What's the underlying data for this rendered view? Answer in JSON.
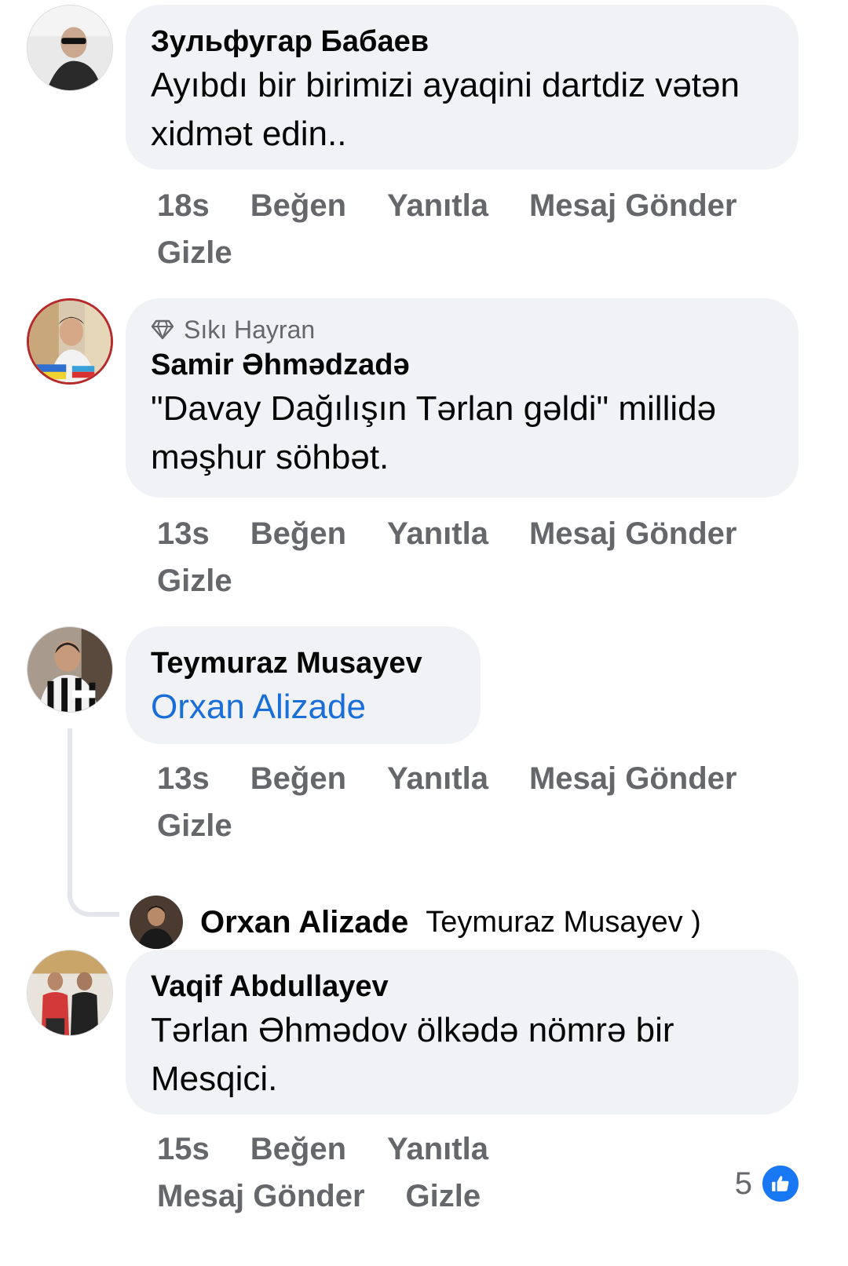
{
  "comments": [
    {
      "author": "Зульфугар Бабаев",
      "text": "Ayıbdı bir birimizi ayaqini dartdiz vətən xidmət edin..",
      "time": "18s",
      "actions": [
        "Beğen",
        "Yanıtla",
        "Mesaj Gönder",
        "Gizle"
      ]
    },
    {
      "badge": "Sıkı Hayran",
      "badge_icon": "diamond-icon",
      "author": "Samir Əhmədzadə",
      "text": "\"Davay Dağılışın Tərlan gəldi\" millidə məşhur söhbət.",
      "time": "13s",
      "actions": [
        "Beğen",
        "Yanıtla",
        "Mesaj Gönder",
        "Gizle"
      ]
    },
    {
      "author": "Teymuraz Musayev",
      "mention": "Orxan Alizade",
      "time": "13s",
      "actions": [
        "Beğen",
        "Yanıtla",
        "Mesaj Gönder",
        "Gizle"
      ],
      "reply": {
        "author": "Orxan Alizade",
        "text": "Teymuraz Musayev )"
      }
    },
    {
      "author": "Vaqif Abdullayev",
      "text": "Tərlan Əhmədov ölkədə nömrə bir Mesqici.",
      "time": "15s",
      "actions": [
        "Beğen",
        "Yanıtla",
        "Mesaj Gönder",
        "Gizle"
      ],
      "reactions": {
        "count": "5",
        "icon": "like-icon",
        "color": "#1877f2"
      }
    }
  ],
  "colors": {
    "bubble": "#f0f2f5",
    "secondary_text": "#65676b",
    "mention": "#1a6ed8",
    "thread_line": "#e4e6eb"
  }
}
